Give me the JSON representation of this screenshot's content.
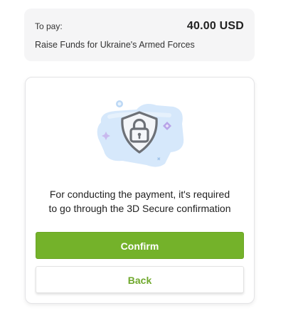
{
  "summary": {
    "to_pay_label": "To pay:",
    "amount": "40.00 USD",
    "description": "Raise Funds for Ukraine's Armed Forces"
  },
  "verification": {
    "illustration_icon": "shield-lock-icon",
    "message_line1": "For conducting the payment, it's required",
    "message_line2": "to go through the 3D Secure confirmation"
  },
  "actions": {
    "confirm_label": "Confirm",
    "back_label": "Back"
  },
  "colors": {
    "accent_green": "#74b22a",
    "back_text_green": "#6fa82c",
    "summary_background": "#f5f5f6",
    "illustration_blue": "#d6e8fb"
  }
}
